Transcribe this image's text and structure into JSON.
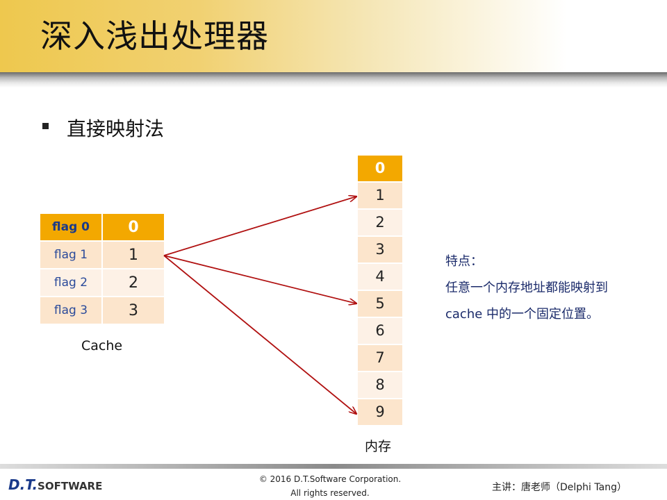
{
  "header": {
    "title": "深入浅出处理器"
  },
  "bullet": {
    "text": "直接映射法"
  },
  "cache": {
    "rows": [
      {
        "flag": "flag 0",
        "value": "0"
      },
      {
        "flag": "flag 1",
        "value": "1"
      },
      {
        "flag": "flag 2",
        "value": "2"
      },
      {
        "flag": "flag 3",
        "value": "3"
      }
    ],
    "label": "Cache"
  },
  "memory": {
    "cells": [
      "0",
      "1",
      "2",
      "3",
      "4",
      "5",
      "6",
      "7",
      "8",
      "9"
    ],
    "label": "内存"
  },
  "note": {
    "line1": "特点：",
    "line2": "任意一个内存地址都能映射到",
    "line3": "cache 中的一个固定位置。"
  },
  "arrows": {
    "from_cache_row": 1,
    "to_memory_cells": [
      1,
      5,
      9
    ],
    "color": "#b01010"
  },
  "colors": {
    "header_cell": "#f3a800",
    "odd_cell": "#fce5cc",
    "even_cell": "#fdf1e6",
    "flag_text": "#2a4a9a"
  },
  "footer": {
    "logo_main": "D.T.",
    "logo_soft": "SOFTWARE",
    "copyright_line1": "© 2016 D.T.Software Corporation.",
    "copyright_line2": "All rights reserved.",
    "lecturer": "主讲：唐老师（Delphi Tang）"
  }
}
